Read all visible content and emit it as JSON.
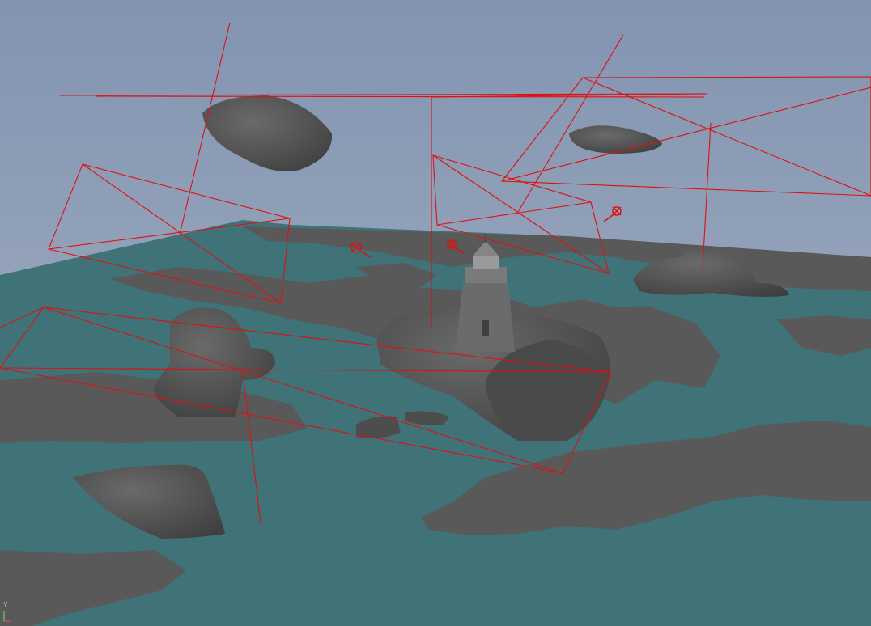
{
  "viewport": {
    "axis_indicator": "y",
    "colors": {
      "sky_top": "#8496b3",
      "sky_bottom": "#a6b2c2",
      "water": "#3f7378",
      "rock": "#585858",
      "rock_shadow": "#3a3a3a",
      "wireframe": "#e01010",
      "axis": "#6fe07a"
    }
  },
  "scene_objects": {
    "lighthouse": "lighthouse-model",
    "lights": [
      "light-gizmo",
      "light-gizmo",
      "light-gizmo"
    ],
    "cameras": [
      "camera-frustum",
      "camera-frustum",
      "camera-frustum",
      "camera-frustum",
      "camera-frustum"
    ]
  }
}
